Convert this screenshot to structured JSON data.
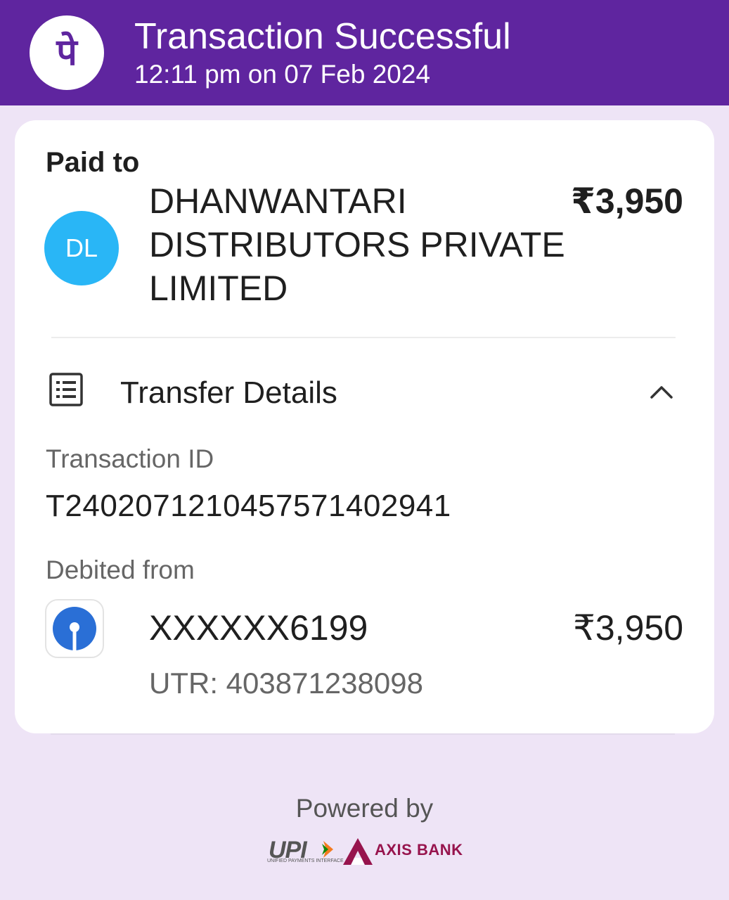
{
  "header": {
    "logo_icon": "phonepe-logo-icon",
    "title": "Transaction Successful",
    "subtitle": "12:11 pm on 07 Feb 2024",
    "color": "#5f259f"
  },
  "payment": {
    "paid_to_label": "Paid to",
    "avatar_initials": "DL",
    "avatar_color": "#29b6f6",
    "payee_name": "DHANWANTARI DISTRIBUTORS PRIVATE LIMITED",
    "amount": "₹3,950"
  },
  "transfer_details": {
    "icon": "receipt-list-icon",
    "label": "Transfer Details",
    "toggle_icon": "chevron-up-icon",
    "transaction_id_label": "Transaction ID",
    "transaction_id": "T2402071210457571402941",
    "debited_from_label": "Debited from",
    "bank_icon": "sbi-bank-icon",
    "account": "XXXXXX6199",
    "account_amount": "₹3,950",
    "utr": "UTR: 403871238098"
  },
  "footer": {
    "powered_by": "Powered by",
    "upi_logo_text": "UPI",
    "upi_subtext": "UNIFIED PAYMENTS INTERFACE",
    "bank_logo_text": "AXIS BANK",
    "bank_brand_color": "#97144d"
  }
}
